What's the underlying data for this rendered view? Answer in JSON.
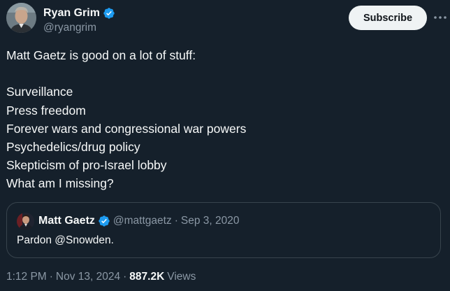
{
  "author": {
    "name": "Ryan Grim",
    "handle": "@ryangrim",
    "verified": true,
    "verified_color": "#1d9bf0"
  },
  "actions": {
    "subscribe_label": "Subscribe",
    "more_icon": "more-horizontal-icon"
  },
  "tweet": {
    "lines": [
      "Matt Gaetz is good on a lot of stuff:",
      "",
      "Surveillance",
      "Press freedom",
      "Forever wars and congressional war powers",
      "Psychedelics/drug policy",
      "Skepticism of pro-Israel lobby",
      "What am I missing?"
    ]
  },
  "quoted_tweet": {
    "name": "Matt Gaetz",
    "handle": "@mattgaetz",
    "separator": "·",
    "date": "Sep 3, 2020",
    "verified": true,
    "text": "Pardon @Snowden."
  },
  "footer": {
    "time": "1:12 PM",
    "separator": "·",
    "date": "Nov 13, 2024",
    "views_count": "887.2K",
    "views_label": "Views"
  },
  "colors": {
    "background": "#15202b",
    "text_primary": "#f7f9f9",
    "text_secondary": "#8b98a5",
    "border": "#38444d",
    "button_bg": "#eff3f4"
  }
}
